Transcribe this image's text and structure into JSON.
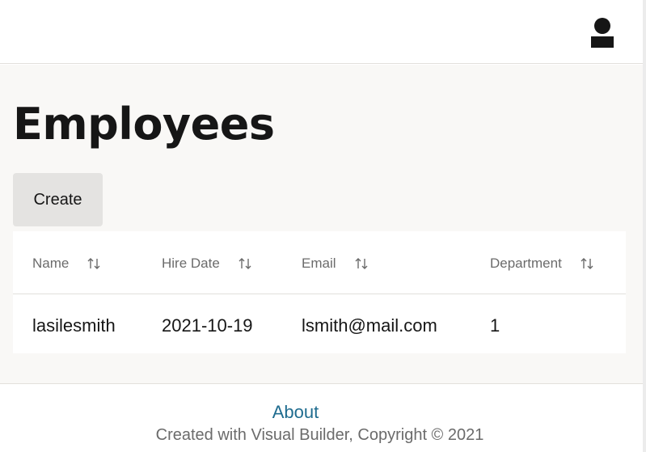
{
  "header": {
    "user_menu_icon": "user-icon"
  },
  "page": {
    "title": "Employees"
  },
  "toolbar": {
    "create_label": "Create"
  },
  "table": {
    "columns": [
      {
        "label": "Name",
        "sort_icon": "sort-icon"
      },
      {
        "label": "Hire Date",
        "sort_icon": "sort-icon"
      },
      {
        "label": "Email",
        "sort_icon": "sort-icon"
      },
      {
        "label": "Department",
        "sort_icon": "sort-icon"
      }
    ],
    "rows": [
      {
        "name": "lasilesmith",
        "hire_date": "2021-10-19",
        "email": "lsmith@mail.com",
        "department": "1"
      }
    ]
  },
  "footer": {
    "about_label": "About",
    "copyright": "Created with Visual Builder, Copyright © 2021"
  },
  "colors": {
    "link": "#1f6c8f",
    "background": "#f9f8f6",
    "button": "#e4e3e1"
  }
}
